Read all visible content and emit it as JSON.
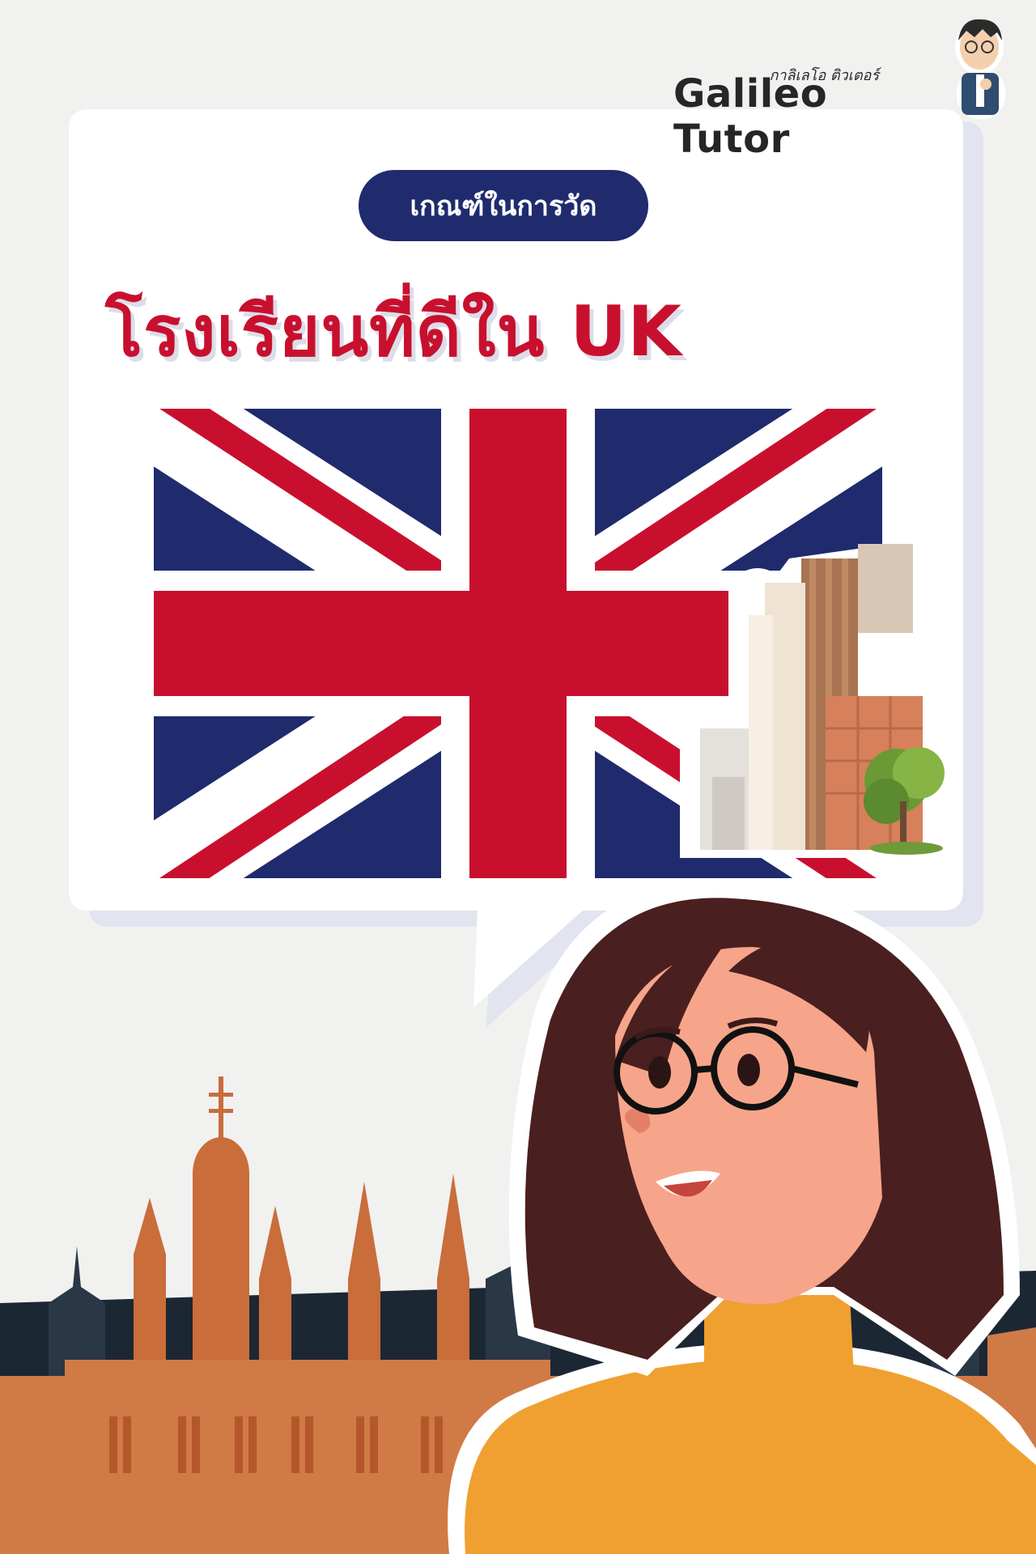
{
  "brand": {
    "name": "Galileo Tutor",
    "thai_name": "กาลิเลโอ ติวเตอร์"
  },
  "header": {
    "subtitle": "เกณฑ์ในการวัด",
    "title": "โรงเรียนที่ดีใน UK"
  },
  "colors": {
    "flag_blue": "#1f2b6d",
    "flag_red": "#c8102e",
    "background": "#f1f1f0",
    "bubble": "#ffffff",
    "skyline": "#d07a45",
    "sweater": "#f0a030",
    "hair": "#4a1f1f"
  },
  "icons": {
    "flag": "uk-flag",
    "building": "building-illustration",
    "mascot": "tutor-mascot",
    "character": "girl-with-glasses"
  }
}
